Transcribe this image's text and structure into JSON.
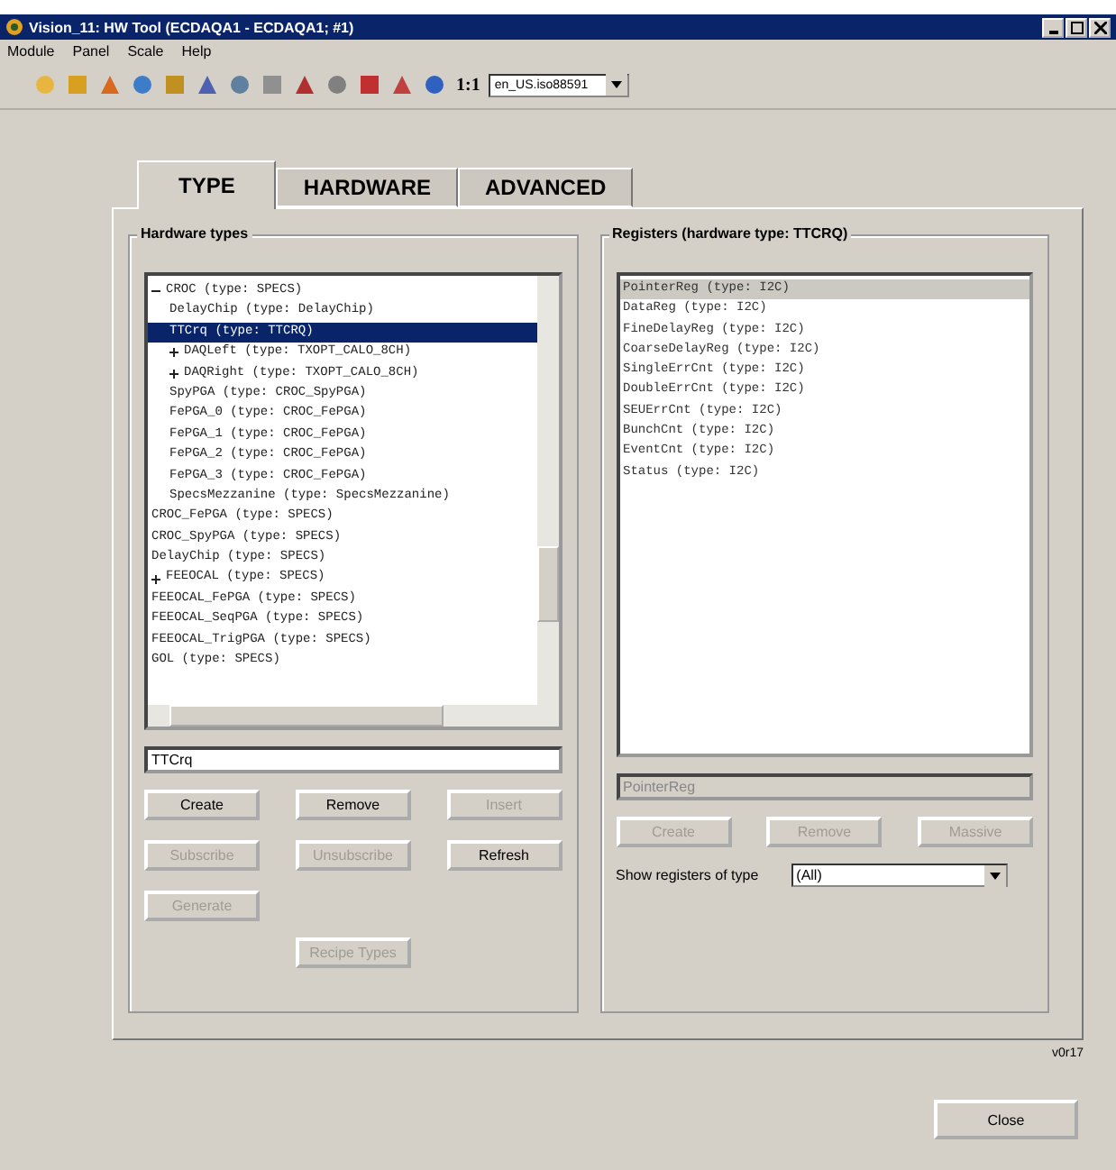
{
  "window": {
    "title": "Vision_11: HW Tool (ECDAQA1 - ECDAQA1; #1)"
  },
  "menu": [
    "Module",
    "Panel",
    "Scale",
    "Help"
  ],
  "toolbar": {
    "zoom_label": "1:1",
    "locale": "en_US.iso88591"
  },
  "tabs": [
    {
      "label": "TYPE",
      "selected": true
    },
    {
      "label": "HARDWARE",
      "selected": false
    },
    {
      "label": "ADVANCED",
      "selected": false
    }
  ],
  "hardware_types": {
    "title": "Hardware types",
    "tree": [
      {
        "label": "CROC (type: SPECS)",
        "expanded": true,
        "selected": false,
        "children": [
          {
            "label": "DelayChip (type: DelayChip)",
            "selected": false
          },
          {
            "label": "TTCrq (type: TTCRQ)",
            "selected": true
          },
          {
            "label": "DAQLeft (type: TXOPT_CALO_8CH)",
            "expanded": false,
            "selected": false
          },
          {
            "label": "DAQRight (type: TXOPT_CALO_8CH)",
            "expanded": false,
            "selected": false
          },
          {
            "label": "SpyPGA (type: CROC_SpyPGA)",
            "selected": false
          },
          {
            "label": "FePGA_0 (type: CROC_FePGA)",
            "selected": false
          },
          {
            "label": "FePGA_1 (type: CROC_FePGA)",
            "selected": false
          },
          {
            "label": "FePGA_2 (type: CROC_FePGA)",
            "selected": false
          },
          {
            "label": "FePGA_3 (type: CROC_FePGA)",
            "selected": false
          },
          {
            "label": "SpecsMezzanine (type: SpecsMezzanine)",
            "selected": false
          }
        ]
      },
      {
        "label": "CROC_FePGA (type: SPECS)",
        "selected": false
      },
      {
        "label": "CROC_SpyPGA (type: SPECS)",
        "selected": false
      },
      {
        "label": "DelayChip (type: SPECS)",
        "selected": false
      },
      {
        "label": "FEEOCAL (type: SPECS)",
        "expanded": false,
        "selected": false
      },
      {
        "label": "FEEOCAL_FePGA (type: SPECS)",
        "selected": false
      },
      {
        "label": "FEEOCAL_SeqPGA (type: SPECS)",
        "selected": false
      },
      {
        "label": "FEEOCAL_TrigPGA (type: SPECS)",
        "selected": false
      },
      {
        "label": "GOL (type: SPECS)",
        "selected": false
      }
    ],
    "name_value": "TTCrq",
    "buttons": [
      {
        "label": "Create",
        "disabled": false
      },
      {
        "label": "Remove",
        "disabled": false
      },
      {
        "label": "Insert",
        "disabled": true
      },
      {
        "label": "Subscribe",
        "disabled": true
      },
      {
        "label": "Unsubscribe",
        "disabled": true
      },
      {
        "label": "Refresh",
        "disabled": false
      },
      {
        "label": "Generate",
        "disabled": true
      }
    ],
    "recipe_button": {
      "label": "Recipe Types",
      "disabled": true
    }
  },
  "registers": {
    "title": "Registers (hardware type: TTCRQ)",
    "items": [
      {
        "label": "PointerReg (type: I2C)",
        "selected": true
      },
      {
        "label": "DataReg (type: I2C)",
        "selected": false
      },
      {
        "label": "FineDelayReg (type: I2C)",
        "selected": false
      },
      {
        "label": "CoarseDelayReg (type: I2C)",
        "selected": false
      },
      {
        "label": "SingleErrCnt (type: I2C)",
        "selected": false
      },
      {
        "label": "DoubleErrCnt (type: I2C)",
        "selected": false
      },
      {
        "label": "SEUErrCnt (type: I2C)",
        "selected": false
      },
      {
        "label": "BunchCnt (type: I2C)",
        "selected": false
      },
      {
        "label": "EventCnt (type: I2C)",
        "selected": false
      },
      {
        "label": "Status (type: I2C)",
        "selected": false
      }
    ],
    "name_value": "PointerReg",
    "buttons": [
      {
        "label": "Create",
        "disabled": true
      },
      {
        "label": "Remove",
        "disabled": true
      },
      {
        "label": "Massive",
        "disabled": true
      }
    ],
    "filter_label": "Show registers of type",
    "filter_value": "(All)"
  },
  "version": "v0r17",
  "close_button": "Close"
}
